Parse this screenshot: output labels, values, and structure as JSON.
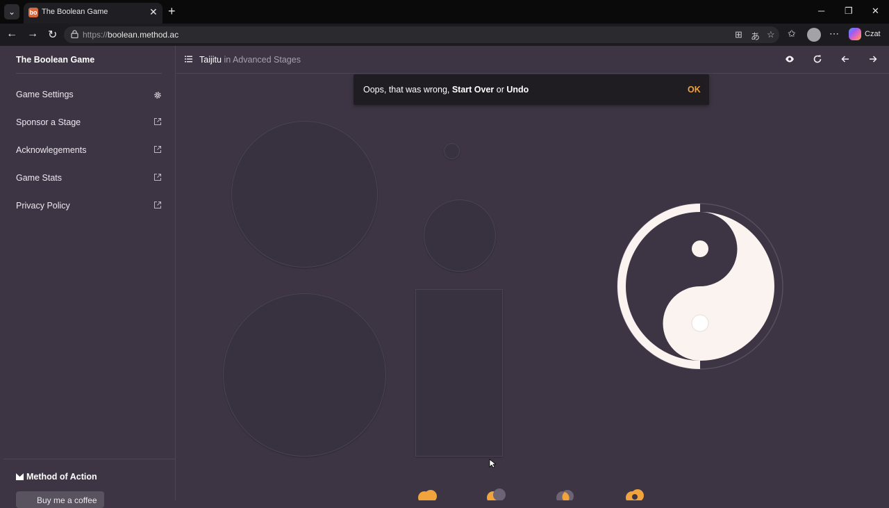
{
  "browser": {
    "tab_title": "The Boolean Game",
    "tab_favicon_text": "bo",
    "url_scheme": "https://",
    "url_host": "boolean.method.ac",
    "copilot_label": "Czat",
    "accent_color": "#d9683a"
  },
  "sidebar": {
    "title": "The Boolean Game",
    "items": [
      {
        "label": "Game Settings",
        "icon": "gear-icon"
      },
      {
        "label": "Sponsor a Stage",
        "icon": "external-link-icon"
      },
      {
        "label": "Acknowlegements",
        "icon": "external-link-icon"
      },
      {
        "label": "Game Stats",
        "icon": "external-link-icon"
      },
      {
        "label": "Privacy Policy",
        "icon": "external-link-icon"
      }
    ],
    "footer_brand": "Method of Action",
    "coffee_label": "Buy me a coffee"
  },
  "header": {
    "stage_name": "Taijitu",
    "stage_suffix": "in Advanced Stages",
    "icons": [
      "eye-icon",
      "refresh-icon",
      "arrow-left-icon",
      "arrow-right-icon"
    ]
  },
  "snackbar": {
    "text_prefix": "Oops, that was wrong, ",
    "start_over": "Start Over",
    "middle": " or ",
    "undo": "Undo",
    "ok_label": "OK",
    "ok_color": "#f1a33c"
  },
  "colors": {
    "background": "#3d3544",
    "shape_fill": "#383240",
    "target_fill": "#fbf3f0",
    "tool_orange": "#f1a33c"
  },
  "canvas": {
    "shapes": [
      "large-circle-top",
      "tiny-circle",
      "medium-circle",
      "large-circle-bottom",
      "tall-rectangle"
    ],
    "target": "taijitu-symbol",
    "tools": [
      "union-tool",
      "subtract-tool",
      "intersect-tool",
      "exclude-tool"
    ]
  }
}
